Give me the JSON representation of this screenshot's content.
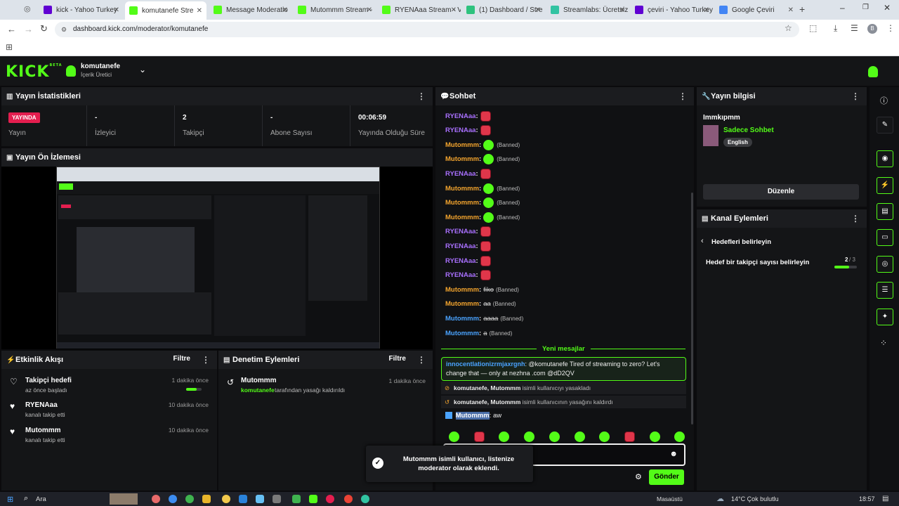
{
  "browser": {
    "tabs": [
      {
        "label": "kick - Yahoo Turkey",
        "color": "#6001d2"
      },
      {
        "label": "komutanefe Stre",
        "color": "#53fc18",
        "active": true
      },
      {
        "label": "Message Moderatio",
        "color": "#53fc18"
      },
      {
        "label": "Mutommm Stream -",
        "color": "#53fc18"
      },
      {
        "label": "RYENAaa Stream - V",
        "color": "#53fc18"
      },
      {
        "label": "(1) Dashboard / Stre",
        "color": "#2ec27e"
      },
      {
        "label": "Streamlabs: Ücretsiz",
        "color": "#31c3a2"
      },
      {
        "label": "çeviri - Yahoo Turkey",
        "color": "#6001d2"
      },
      {
        "label": "Google Çeviri",
        "color": "#4285f4"
      }
    ],
    "url": "dashboard.kick.com/moderator/komutanefe",
    "profile_initial": "B"
  },
  "header": {
    "logo": "KICK",
    "logo_badge": "BETA",
    "channel": "komutanefe",
    "role": "İçerik Üretici"
  },
  "stats_panel": {
    "title": "Yayın İstatistikleri",
    "live_badge": "YAYINDA",
    "stats": [
      {
        "value": "",
        "label": "Yayın"
      },
      {
        "value": "-",
        "label": "İzleyici"
      },
      {
        "value": "2",
        "label": "Takipçi"
      },
      {
        "value": "-",
        "label": "Abone Sayısı"
      },
      {
        "value": "00:06:59",
        "label": "Yayında Olduğu Süre"
      }
    ]
  },
  "preview_panel": {
    "title": "Yayın Ön İzlemesi"
  },
  "activity_panel": {
    "title": "Etkinlik Akışı",
    "filter": "Filtre",
    "items": [
      {
        "icon": "heart-outline-icon",
        "title": "Takipçi hedefi",
        "sub": "az önce başladı",
        "time": "1 dakika önce",
        "progress": 0.67
      },
      {
        "icon": "heart-icon",
        "title": "RYENAaa",
        "sub": "kanalı takip etti",
        "time": "10 dakika önce"
      },
      {
        "icon": "heart-icon",
        "title": "Mutommm",
        "sub": "kanalı takip etti",
        "time": "10 dakika önce"
      }
    ]
  },
  "audit_panel": {
    "title": "Denetim Eylemleri",
    "filter": "Filtre",
    "items": [
      {
        "title": "Mutommm",
        "actor": "komutanefe",
        "text": "tarafından yasağı kaldırıldı",
        "time": "1 dakika önce"
      }
    ]
  },
  "chat_panel": {
    "title": "Sohbet",
    "messages": [
      {
        "user": "RYENAaa",
        "color": "purple",
        "emote": "red",
        "extra": ""
      },
      {
        "user": "RYENAaa",
        "color": "purple",
        "emote": "red",
        "extra": ""
      },
      {
        "user": "Mutommm",
        "color": "orange",
        "emote": "grn",
        "extra": "(Banned)"
      },
      {
        "user": "Mutommm",
        "color": "orange",
        "emote": "grn",
        "extra": "(Banned)"
      },
      {
        "user": "RYENAaa",
        "color": "purple",
        "emote": "red",
        "extra": ""
      },
      {
        "user": "Mutommm",
        "color": "orange",
        "emote": "grn",
        "extra": "(Banned)"
      },
      {
        "user": "Mutommm",
        "color": "orange",
        "emote": "grn",
        "extra": "(Banned)"
      },
      {
        "user": "Mutommm",
        "color": "orange",
        "emote": "grn",
        "extra": "(Banned)"
      },
      {
        "user": "RYENAaa",
        "color": "purple",
        "emote": "red",
        "extra": ""
      },
      {
        "user": "RYENAaa",
        "color": "purple",
        "emote": "red",
        "extra": ""
      },
      {
        "user": "RYENAaa",
        "color": "purple",
        "emote": "red",
        "extra": ""
      },
      {
        "user": "RYENAaa",
        "color": "purple",
        "emote": "red",
        "extra": ""
      },
      {
        "user": "Mutommm",
        "color": "orange",
        "emote": "",
        "text": "fiko",
        "extra": "(Banned)"
      },
      {
        "user": "Mutommm",
        "color": "orange",
        "emote": "",
        "text": "aa",
        "extra": "(Banned)"
      },
      {
        "user": "Mutommm",
        "color": "blue",
        "emote": "",
        "text": "aaaa",
        "extra": "(Banned)"
      },
      {
        "user": "Mutommm",
        "color": "blue",
        "emote": "",
        "text": "a",
        "extra": "(Banned)"
      }
    ],
    "new_messages": "Yeni mesajlar",
    "highlight": {
      "user": "innocentlationizrmjaxrgnh",
      "text": ": @komutanefe Tired of streaming to zero? Let's change that — only at nezhna .com @dD2QV"
    },
    "mod_events": [
      {
        "actor": "komutanefe, Mutommm",
        "text": "isimli kullanıcıyı yasakladı"
      },
      {
        "actor": "komutanefe, Mutommm",
        "text": "isimli kullanıcının yasağını kaldırdı"
      }
    ],
    "last_message": {
      "user": "Mutommm",
      "text": ": aw"
    },
    "send": "Gönder"
  },
  "toast": {
    "text": "Mutommm isimli kullanıcı, listenize moderator olarak eklendi."
  },
  "info_panel": {
    "title": "Yayın bilgisi",
    "stream_title": "Immkıpmm",
    "category": "Sadece Sohbet",
    "language": "English",
    "edit": "Düzenle"
  },
  "actions_panel": {
    "title": "Kanal Eylemleri",
    "back": "Hedefleri belirleyin",
    "goal": "Hedef bir takipçi sayısı belirleyin",
    "goal_current": "2",
    "goal_total": "/ 3",
    "goal_progress": 0.67
  },
  "taskbar": {
    "search": "Ara",
    "desktop": "Masaüstü",
    "weather": "14°C  Çok bulutlu",
    "time": "18:57"
  }
}
